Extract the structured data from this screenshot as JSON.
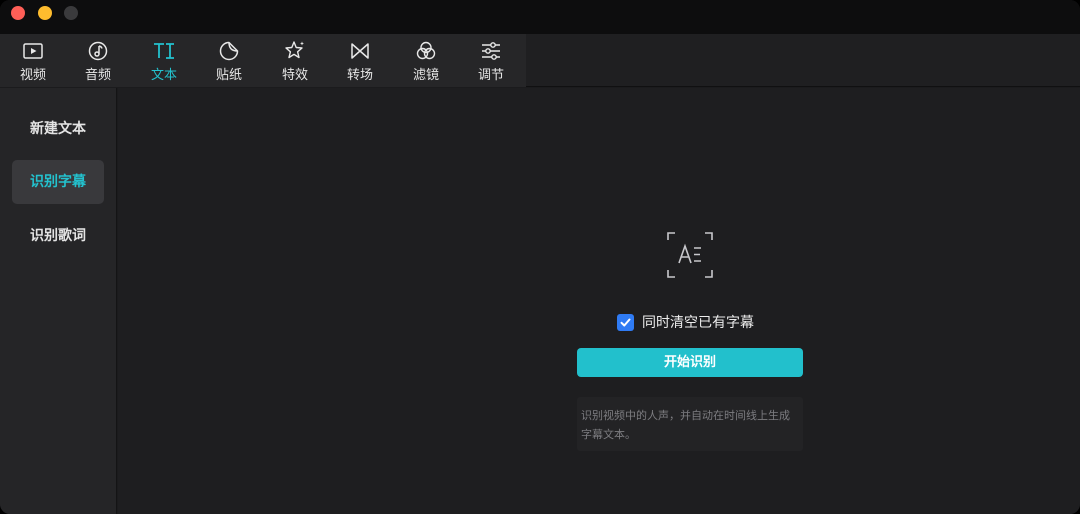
{
  "window": {
    "traffic_lights": [
      "close",
      "minimize",
      "maximize"
    ]
  },
  "toolbar": {
    "tools": [
      {
        "label": "视频",
        "icon": "video-icon"
      },
      {
        "label": "音频",
        "icon": "music-note-icon"
      },
      {
        "label": "文本",
        "icon": "text-icon",
        "active": true
      },
      {
        "label": "贴纸",
        "icon": "sticker-icon"
      },
      {
        "label": "特效",
        "icon": "sparkle-star-icon"
      },
      {
        "label": "转场",
        "icon": "transition-bowtie-icon"
      },
      {
        "label": "滤镜",
        "icon": "filter-circles-icon"
      },
      {
        "label": "调节",
        "icon": "sliders-icon"
      }
    ]
  },
  "sidebar": {
    "items": [
      {
        "label": "新建文本"
      },
      {
        "label": "识别字幕",
        "active": true
      },
      {
        "label": "识别歌词"
      }
    ]
  },
  "main": {
    "icon": "text-recognition-icon",
    "checkbox": {
      "label": "同时清空已有字幕",
      "checked": true
    },
    "start_button": "开始识别",
    "hint": "识别视频中的人声，并自动在时间线上生成字幕文本。"
  },
  "colors": {
    "accent": "#23c2ce",
    "button": "#22c0cc",
    "checkbox": "#2f7bf4",
    "background": "#1e1e20"
  }
}
